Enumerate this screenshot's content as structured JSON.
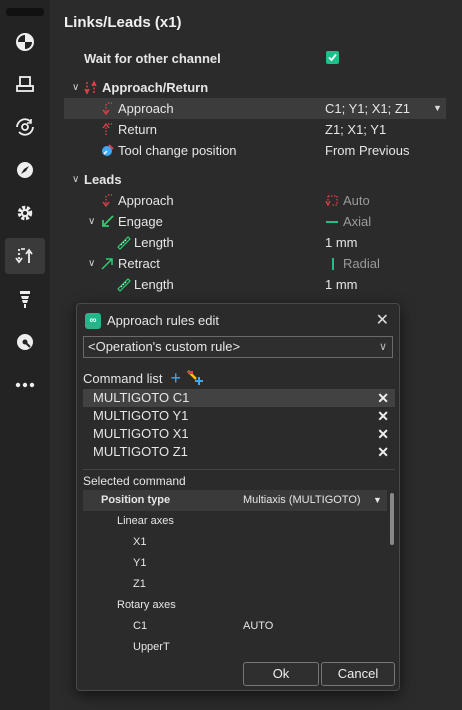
{
  "sidebar": {
    "items": [
      {
        "icon": "pie-chart-icon"
      },
      {
        "icon": "stock-icon"
      },
      {
        "icon": "rotate-icon"
      },
      {
        "icon": "compass-icon"
      },
      {
        "icon": "gear-icon"
      },
      {
        "icon": "links-leads-icon"
      },
      {
        "icon": "tool-icon"
      },
      {
        "icon": "simulation-icon"
      },
      {
        "icon": "more-icon"
      }
    ]
  },
  "panel": {
    "title": "Links/Leads (x1)",
    "wait_label": "Wait for other channel",
    "approach_return": {
      "label": "Approach/Return",
      "approach_label": "Approach",
      "approach_value": "C1; Y1; X1; Z1",
      "return_label": "Return",
      "return_value": "Z1; X1; Y1",
      "tool_change_label": "Tool change position",
      "tool_change_value": "From Previous"
    },
    "leads": {
      "label": "Leads",
      "approach_label": "Approach",
      "approach_value": "Auto",
      "engage_label": "Engage",
      "engage_value": "Axial",
      "engage_length_label": "Length",
      "engage_length_value": "1 mm",
      "retract_label": "Retract",
      "retract_value": "Radial",
      "retract_length_label": "Length",
      "retract_length_value": "1 mm"
    }
  },
  "dialog": {
    "title": "Approach rules edit",
    "rule_select": "<Operation's custom rule>",
    "command_list_label": "Command list",
    "commands": [
      "MULTIGOTO C1",
      "MULTIGOTO Y1",
      "MULTIGOTO X1",
      "MULTIGOTO Z1"
    ],
    "selected_command_label": "Selected command",
    "props": {
      "position_type_label": "Position type",
      "position_type_value": "Multiaxis (MULTIGOTO)",
      "linear_axes_label": "Linear axes",
      "x1": "X1",
      "y1": "Y1",
      "z1": "Z1",
      "rotary_axes_label": "Rotary axes",
      "c1": "C1",
      "c1_value": "AUTO",
      "uppert": "UpperT"
    },
    "ok_label": "Ok",
    "cancel_label": "Cancel"
  },
  "colors": {
    "accent": "#1fbf8c",
    "red_icon": "#e0404a",
    "green_icon": "#2ecc71",
    "blue_icon": "#3fa9f5"
  }
}
